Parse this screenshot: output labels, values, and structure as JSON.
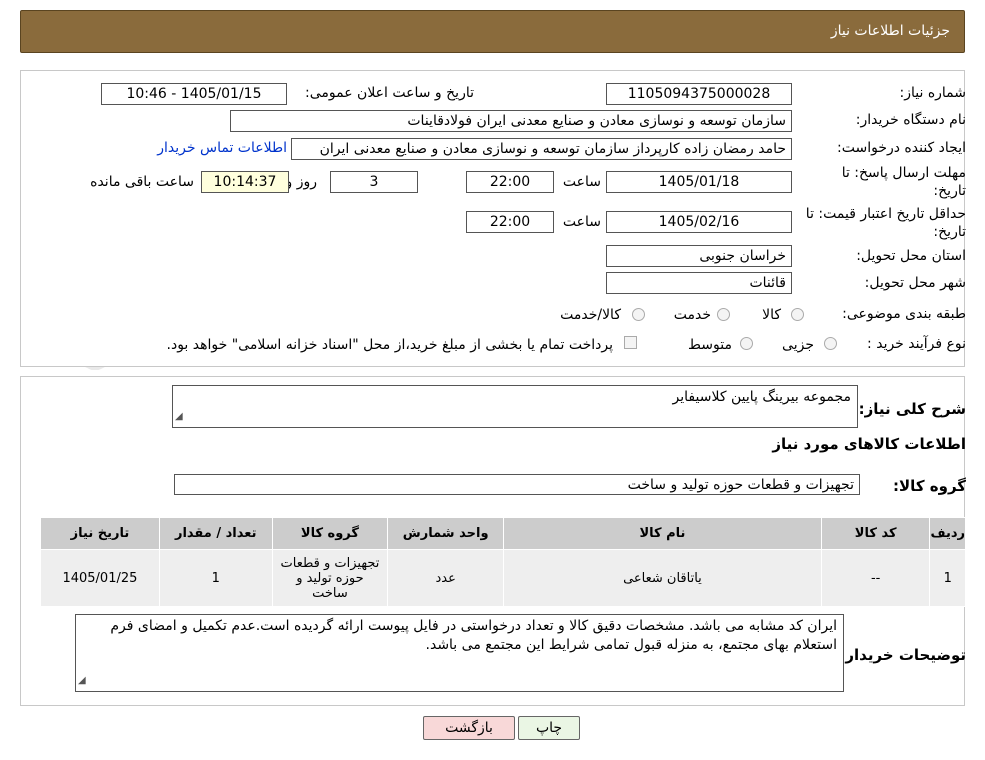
{
  "header": {
    "title": "جزئیات اطلاعات نیاز"
  },
  "form": {
    "need_number_label": "شماره نیاز:",
    "need_number": "1105094375000028",
    "announce_label": "تاریخ و ساعت اعلان عمومی:",
    "announce_value": "1405/01/15 - 10:46",
    "buyer_org_label": "نام دستگاه خریدار:",
    "buyer_org": "سازمان توسعه و نوسازی معادن و صنایع معدنی ایران فولادقاینات",
    "creator_label": "ایجاد کننده درخواست:",
    "creator": "حامد  رمضان زاده  کارپرداز  سازمان توسعه و نوسازی معادن و صنایع معدنی ایران",
    "contact_link": "اطلاعات تماس خریدار",
    "reply_deadline_label_1": "مهلت ارسال پاسخ: تا",
    "reply_deadline_label_2": "تاریخ:",
    "reply_date": "1405/01/18",
    "time_label": "ساعت",
    "reply_time": "22:00",
    "days_value": "3",
    "days_label": "روز و",
    "remaining_time": "10:14:37",
    "remaining_label": "ساعت باقی مانده",
    "price_validity_label_1": "حداقل تاریخ اعتبار قیمت: تا",
    "price_validity_label_2": "تاریخ:",
    "validity_date": "1405/02/16",
    "validity_time": "22:00",
    "province_label": "استان محل تحویل:",
    "province": "خراسان جنوبی",
    "city_label": "شهر محل تحویل:",
    "city": "قائنات",
    "category_label": "طبقه بندی موضوعی:",
    "category_options": [
      "کالا",
      "خدمت",
      "کالا/خدمت"
    ],
    "process_label": "نوع فرآیند خرید :",
    "process_options": [
      "جزیی",
      "متوسط"
    ],
    "payment_note": "پرداخت تمام یا بخشی از مبلغ خرید،از محل \"اسناد خزانه اسلامی\" خواهد بود."
  },
  "details": {
    "summary_label": "شرح کلی نیاز:",
    "summary": "مجموعه بیرینگ پایین کلاسیفایر",
    "goods_info_title": "اطلاعات کالاهای مورد نیاز",
    "goods_group_label": "گروه کالا:",
    "goods_group": "تجهیزات و قطعات حوزه تولید و ساخت"
  },
  "table": {
    "headers": [
      "ردیف",
      "کد کالا",
      "نام کالا",
      "واحد شمارش",
      "گروه کالا",
      "تعداد / مقدار",
      "تاریخ نیاز"
    ],
    "rows": [
      [
        "1",
        "--",
        "یاتاقان شعاعی",
        "عدد",
        "تجهیزات و قطعات حوزه تولید و ساخت",
        "1",
        "1405/01/25"
      ]
    ]
  },
  "notes": {
    "label": "توضیحات خریدار:",
    "text": "ایران کد مشابه می باشد. مشخصات دقیق کالا و تعداد درخواستی در فایل پیوست ارائه گردیده است.عدم تکمیل و امضای فرم استعلام بهای مجتمع، به منزله قبول تمامی شرایط این مجتمع می باشد."
  },
  "buttons": {
    "print": "چاپ",
    "back": "بازگشت"
  },
  "watermark": {
    "text": "AriaTender.neT"
  },
  "colors": {
    "header_bg": "#8a6b3c",
    "link": "#0033cc",
    "back_button_bg": "#f8d8d8",
    "print_button_bg": "#eaf6e4"
  }
}
